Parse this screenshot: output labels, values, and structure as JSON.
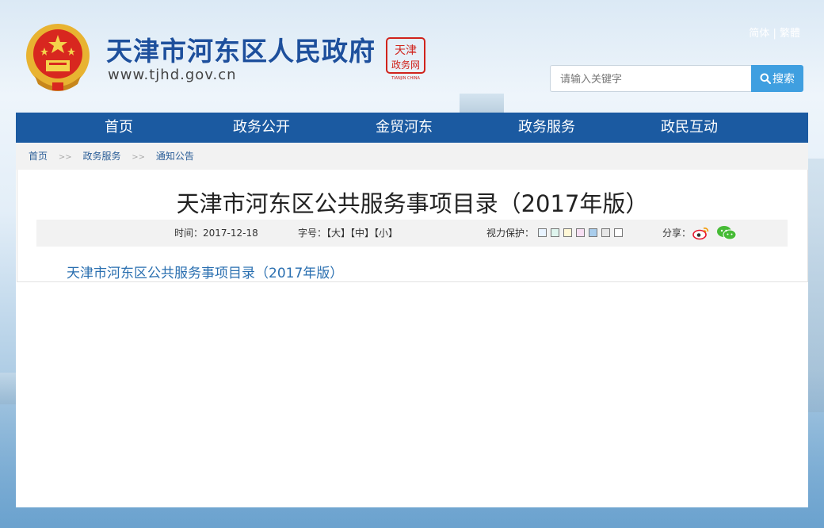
{
  "header": {
    "site_title": "天津市河东区人民政府",
    "site_url": "www.tjhd.gov.cn",
    "seal_text": "天津 政务网",
    "seal_caption": "TIANJIN CHINA",
    "lang_simplified": "简体",
    "lang_separator": "|",
    "lang_traditional": "繁體",
    "search_placeholder": "请输入关键字",
    "search_button": "搜索"
  },
  "nav": {
    "items": [
      "首页",
      "政务公开",
      "金贸河东",
      "政务服务",
      "政民互动"
    ]
  },
  "breadcrumb": {
    "items": [
      "首页",
      "政务服务",
      "通知公告"
    ],
    "separator": ">>"
  },
  "article": {
    "title": "天津市河东区公共服务事项目录（2017年版）",
    "date": "时间：2017-12-18",
    "font_size_label": "字号：",
    "font_large": "【大】",
    "font_medium": "【中】",
    "font_small": "【小】",
    "vision_label": "视力保护：",
    "vision_colors": [
      "#e8f3ff",
      "#dff5ee",
      "#fff8d6",
      "#f7dff3",
      "#a9cdec",
      "#e6e6e6",
      "#ffffff"
    ],
    "share_label": "分享：",
    "link_text": "天津市河东区公共服务事项目录（2017年版）"
  },
  "colors": {
    "nav_bg": "#1b5aa1",
    "search_button": "#3f9fe0",
    "title_blue": "#1d4f9c",
    "link_blue": "#2a6fb0",
    "weibo_red": "#e6162d",
    "wechat_green": "#46bb36"
  }
}
